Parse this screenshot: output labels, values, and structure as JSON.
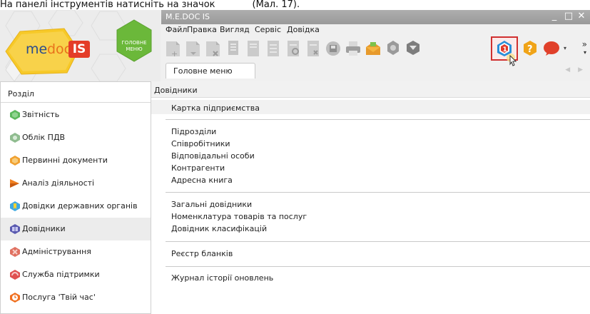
{
  "doc_caption": {
    "text_left": "На панелі інструментів натисніть на значок",
    "text_right": "(Мал. 17)."
  },
  "window": {
    "title": "M.E.DOC IS",
    "minimize_glyph": "_",
    "maximize_glyph": "□",
    "close_glyph": "✕"
  },
  "branding": {
    "logo_me": "me",
    "logo_doc": "doc",
    "logo_is": "IS",
    "home_button_line1": "ГОЛОВНЕ",
    "home_button_line2": "МЕНЮ"
  },
  "menu": {
    "items": [
      "Файл",
      "Правка",
      "Вигляд",
      "Сервіс",
      "Довідка"
    ]
  },
  "toolbar": {
    "overflow_glyph": "»",
    "dropdown_glyph": "▾",
    "highlight_color": "#d03030",
    "buttons": [
      {
        "icon": "new-document-icon"
      },
      {
        "icon": "open-document-icon"
      },
      {
        "icon": "delete-document-icon"
      },
      {
        "icon": "copy-document-icon"
      },
      {
        "icon": "edit-document-icon"
      },
      {
        "icon": "list-document-icon"
      },
      {
        "icon": "search-document-icon"
      },
      {
        "icon": "remove-document-icon"
      },
      {
        "icon": "save-disk-icon"
      },
      {
        "icon": "print-icon"
      },
      {
        "icon": "mail-icon"
      },
      {
        "icon": "settings-gear-icon"
      },
      {
        "icon": "shield-icon"
      },
      {
        "icon": "update-icon"
      },
      {
        "icon": "help-icon"
      },
      {
        "icon": "chat-bubble-icon"
      }
    ]
  },
  "tabs": {
    "active_label": "Головне меню",
    "scroll_arrows": "◀ ▶"
  },
  "sidebar": {
    "title": "Розділ",
    "items": [
      {
        "label": "Звітність",
        "icon": "reports-icon",
        "color": "#5cb85c"
      },
      {
        "label": "Облік ПДВ",
        "icon": "vat-icon",
        "color": "#8fbc8f"
      },
      {
        "label": "Первинні документи",
        "icon": "primary-documents-icon",
        "color": "#f0a030"
      },
      {
        "label": "Аналіз діяльності",
        "icon": "activity-analysis-icon",
        "color": "#f08020"
      },
      {
        "label": "Довідки державних органів",
        "icon": "state-certificates-icon",
        "color": "#3fa9e0"
      },
      {
        "label": "Довідники",
        "icon": "directories-icon",
        "color": "#5a5ab0"
      },
      {
        "label": "Адміністрування",
        "icon": "administration-icon",
        "color": "#e07060"
      },
      {
        "label": "Служба підтримки",
        "icon": "support-icon",
        "color": "#e05050"
      },
      {
        "label": "Послуга 'Твій час'",
        "icon": "your-time-icon",
        "color": "#f07020"
      }
    ],
    "active_index": 5
  },
  "main": {
    "header": "Довідники",
    "highlighted_item": "Картка підприємства",
    "groups": [
      [
        "Підрозділи",
        "Співробітники",
        "Відповідальні особи",
        "Контрагенти",
        "Адресна книга"
      ],
      [
        "Загальні довідники",
        "Номенклатура товарів та послуг",
        "Довідник класифікацій"
      ],
      [
        "Реєстр бланків"
      ],
      [
        "Журнал історії оновлень"
      ]
    ]
  }
}
